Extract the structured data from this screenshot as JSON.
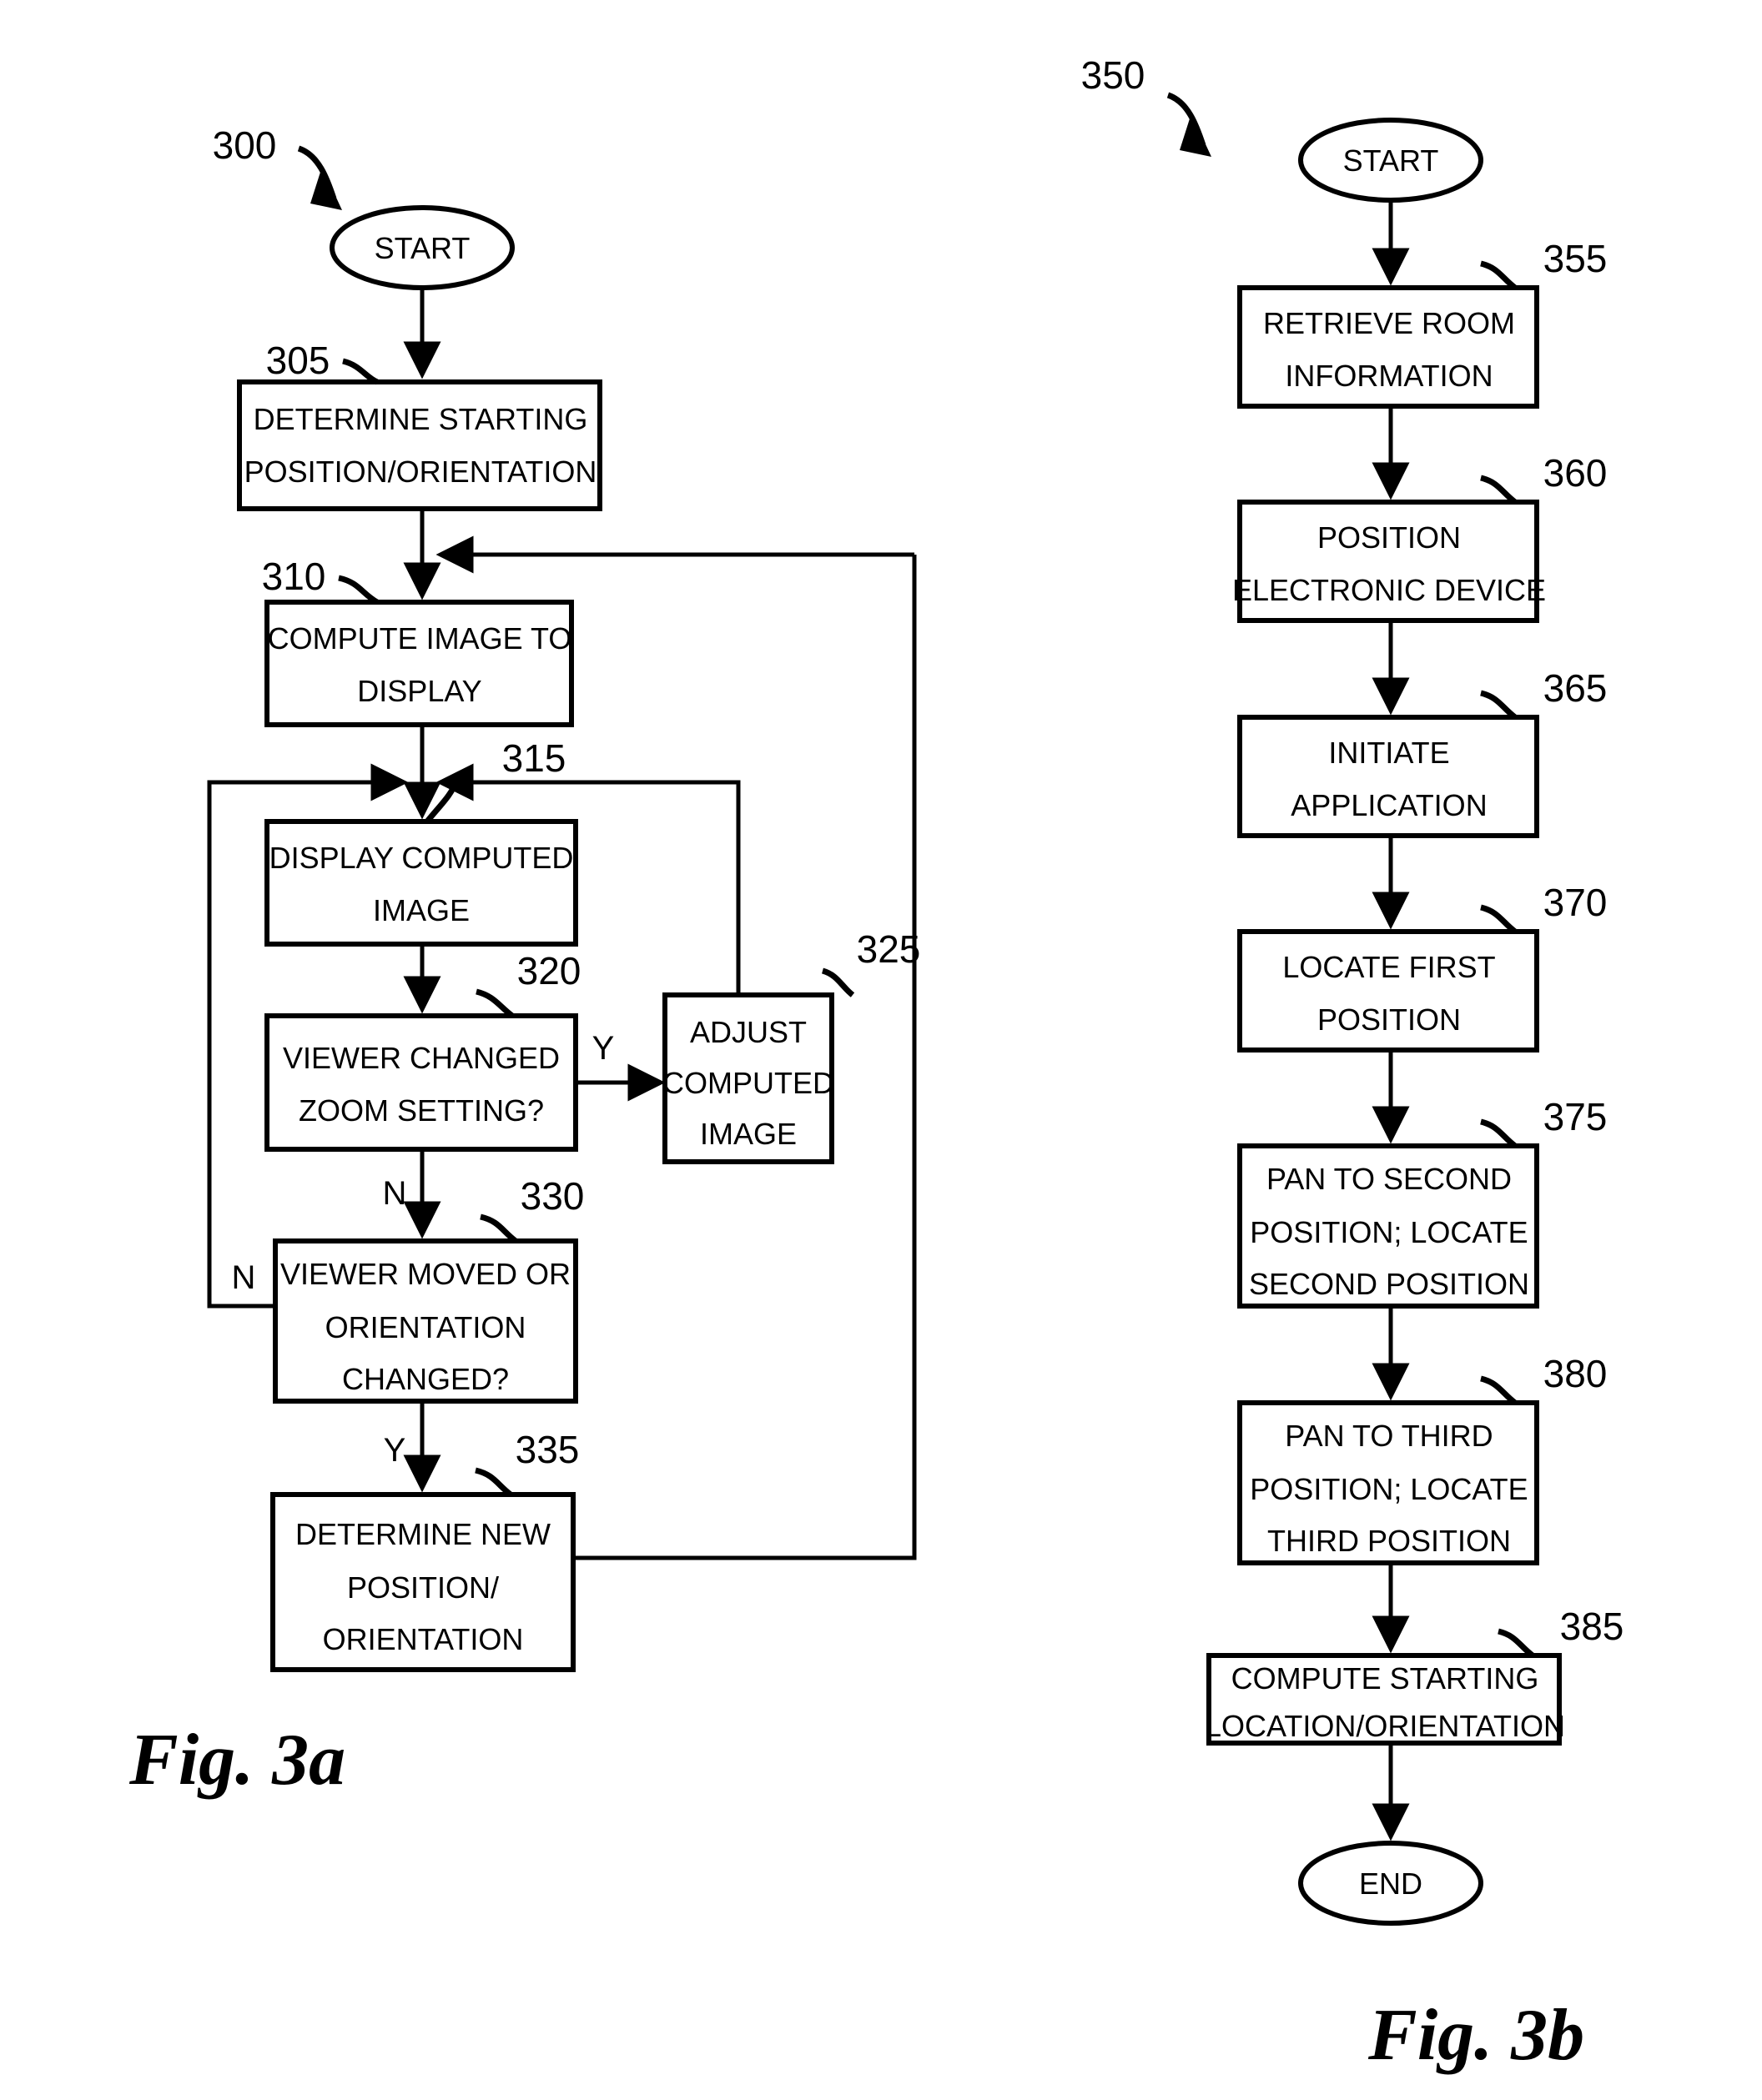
{
  "figures": [
    {
      "id": "fig-3a",
      "caption": "Fig. 3a",
      "ref_number": "300",
      "nodes": [
        {
          "ref": "",
          "shape": "terminator",
          "lines": [
            "START"
          ]
        },
        {
          "ref": "305",
          "shape": "process",
          "lines": [
            "DETERMINE STARTING",
            "POSITION/ORIENTATION"
          ]
        },
        {
          "ref": "310",
          "shape": "process",
          "lines": [
            "COMPUTE IMAGE TO",
            "DISPLAY"
          ]
        },
        {
          "ref": "315",
          "shape": "process",
          "lines": [
            "DISPLAY COMPUTED",
            "IMAGE"
          ]
        },
        {
          "ref": "320",
          "shape": "decision",
          "lines": [
            "VIEWER CHANGED",
            "ZOOM SETTING?"
          ]
        },
        {
          "ref": "325",
          "shape": "process",
          "lines": [
            "ADJUST",
            "COMPUTED",
            "IMAGE"
          ]
        },
        {
          "ref": "330",
          "shape": "decision",
          "lines": [
            "VIEWER MOVED OR",
            "ORIENTATION",
            "CHANGED?"
          ]
        },
        {
          "ref": "335",
          "shape": "process",
          "lines": [
            "DETERMINE NEW",
            "POSITION/",
            "ORIENTATION"
          ]
        }
      ],
      "branch_labels": [
        {
          "label": "Y",
          "from": "320",
          "to": "325"
        },
        {
          "label": "N",
          "from": "320",
          "to": "330"
        },
        {
          "label": "N",
          "from": "330",
          "to": "315"
        },
        {
          "label": "Y",
          "from": "330",
          "to": "335"
        }
      ]
    },
    {
      "id": "fig-3b",
      "caption": "Fig. 3b",
      "ref_number": "350",
      "nodes": [
        {
          "ref": "",
          "shape": "terminator",
          "lines": [
            "START"
          ]
        },
        {
          "ref": "355",
          "shape": "process",
          "lines": [
            "RETRIEVE ROOM",
            "INFORMATION"
          ]
        },
        {
          "ref": "360",
          "shape": "process",
          "lines": [
            "POSITION",
            "ELECTRONIC DEVICE"
          ]
        },
        {
          "ref": "365",
          "shape": "process",
          "lines": [
            "INITIATE",
            "APPLICATION"
          ]
        },
        {
          "ref": "370",
          "shape": "process",
          "lines": [
            "LOCATE FIRST",
            "POSITION"
          ]
        },
        {
          "ref": "375",
          "shape": "process",
          "lines": [
            "PAN TO SECOND",
            "POSITION; LOCATE",
            "SECOND POSITION"
          ]
        },
        {
          "ref": "380",
          "shape": "process",
          "lines": [
            "PAN TO THIRD",
            "POSITION; LOCATE",
            "THIRD POSITION"
          ]
        },
        {
          "ref": "385",
          "shape": "process",
          "lines": [
            "COMPUTE STARTING",
            "LOCATION/ORIENTATION"
          ]
        },
        {
          "ref": "",
          "shape": "terminator",
          "lines": [
            "END"
          ]
        }
      ],
      "branch_labels": []
    }
  ],
  "text": {
    "start": "START",
    "end": "END",
    "ref_300": "300",
    "ref_305": "305",
    "ref_310": "310",
    "ref_315": "315",
    "ref_320": "320",
    "ref_325": "325",
    "ref_330": "330",
    "ref_335": "335",
    "ref_350": "350",
    "ref_355": "355",
    "ref_360": "360",
    "ref_365": "365",
    "ref_370": "370",
    "ref_375": "375",
    "ref_380": "380",
    "ref_385": "385",
    "n305_l1": "DETERMINE STARTING",
    "n305_l2": "POSITION/ORIENTATION",
    "n310_l1": "COMPUTE IMAGE TO",
    "n310_l2": "DISPLAY",
    "n315_l1": "DISPLAY COMPUTED",
    "n315_l2": "IMAGE",
    "n320_l1": "VIEWER CHANGED",
    "n320_l2": "ZOOM SETTING?",
    "n325_l1": "ADJUST",
    "n325_l2": "COMPUTED",
    "n325_l3": "IMAGE",
    "n330_l1": "VIEWER MOVED OR",
    "n330_l2": "ORIENTATION",
    "n330_l3": "CHANGED?",
    "n335_l1": "DETERMINE NEW",
    "n335_l2": "POSITION/",
    "n335_l3": "ORIENTATION",
    "n355_l1": "RETRIEVE ROOM",
    "n355_l2": "INFORMATION",
    "n360_l1": "POSITION",
    "n360_l2": "ELECTRONIC DEVICE",
    "n365_l1": "INITIATE",
    "n365_l2": "APPLICATION",
    "n370_l1": "LOCATE FIRST",
    "n370_l2": "POSITION",
    "n375_l1": "PAN TO SECOND",
    "n375_l2": "POSITION; LOCATE",
    "n375_l3": "SECOND POSITION",
    "n380_l1": "PAN TO THIRD",
    "n380_l2": "POSITION; LOCATE",
    "n380_l3": "THIRD POSITION",
    "n385_l1": "COMPUTE STARTING",
    "n385_l2": "LOCATION/ORIENTATION",
    "br_y1": "Y",
    "br_n1": "N",
    "br_n2": "N",
    "br_y2": "Y",
    "fig3a_caption": "Fig. 3a",
    "fig3b_caption": "Fig. 3b"
  },
  "colors": {
    "stroke": "#000000",
    "background": "#ffffff"
  }
}
